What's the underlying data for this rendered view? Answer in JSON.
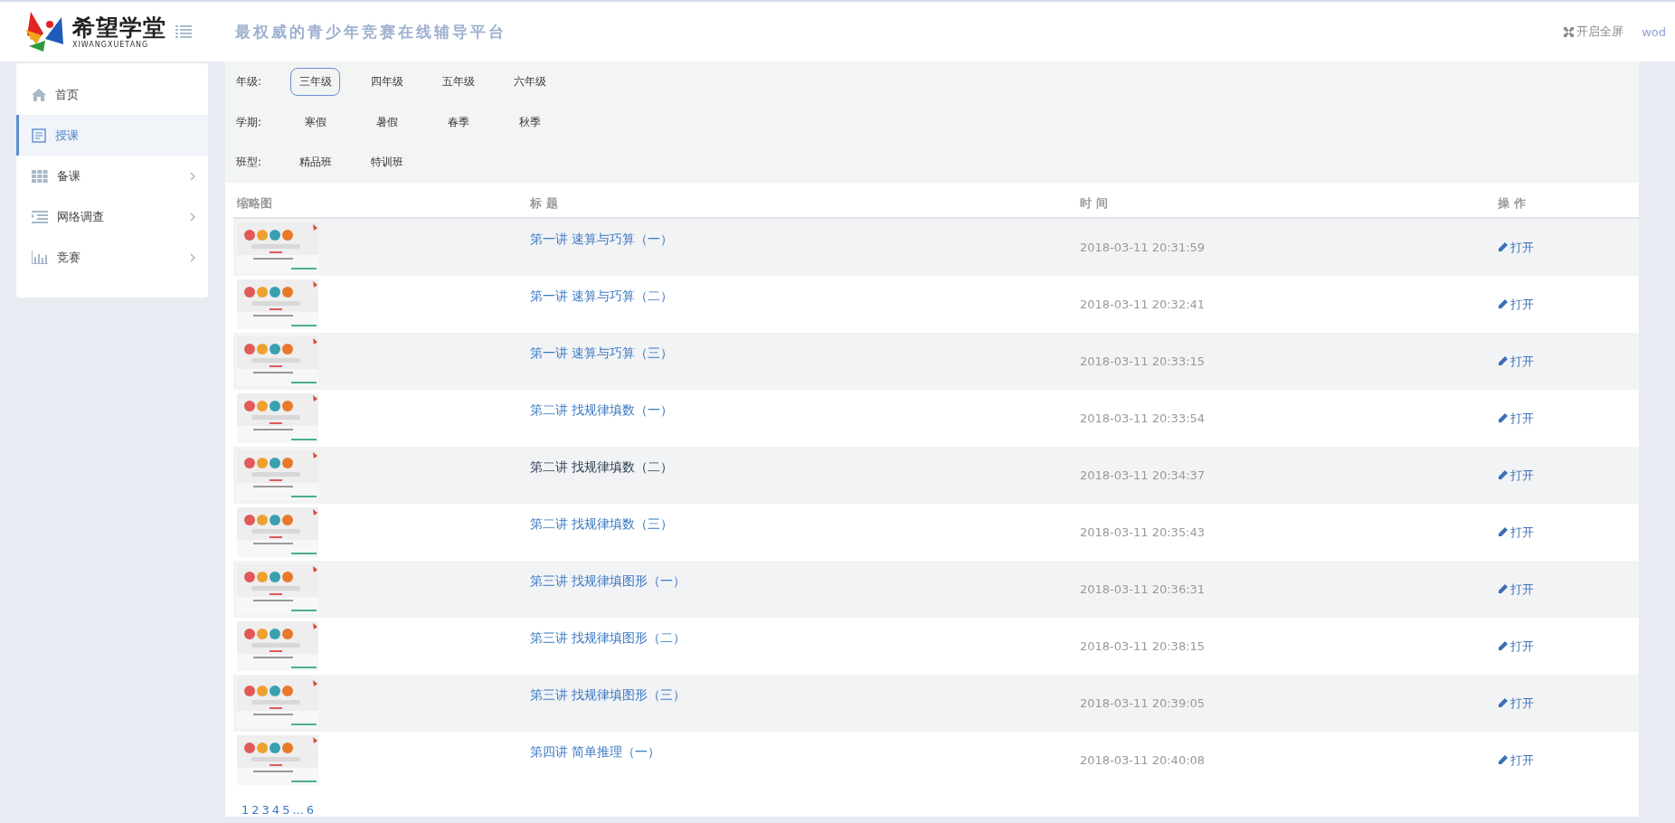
{
  "header": {
    "brand": "希望学堂",
    "brand_sub": "XIWANGXUETANG",
    "slogan": "最权威的青少年竞赛在线辅导平台",
    "fullscreen": "开启全屏",
    "user": "wod"
  },
  "sidebar": {
    "items": [
      {
        "label": "首页",
        "selected": false,
        "expandable": false
      },
      {
        "label": "授课",
        "selected": true,
        "expandable": false
      },
      {
        "label": "备课",
        "selected": false,
        "expandable": true
      },
      {
        "label": "网络调查",
        "selected": false,
        "expandable": true
      },
      {
        "label": "竞赛",
        "selected": false,
        "expandable": true
      }
    ]
  },
  "filters": [
    {
      "label": "年级:",
      "options": [
        {
          "label": "三年级",
          "selected": true
        },
        {
          "label": "四年级",
          "selected": false
        },
        {
          "label": "五年级",
          "selected": false
        },
        {
          "label": "六年级",
          "selected": false
        }
      ]
    },
    {
      "label": "学期:",
      "options": [
        {
          "label": "寒假",
          "selected": false
        },
        {
          "label": "暑假",
          "selected": false
        },
        {
          "label": "春季",
          "selected": false
        },
        {
          "label": "秋季",
          "selected": false
        }
      ]
    },
    {
      "label": "班型:",
      "options": [
        {
          "label": "精品班",
          "selected": false
        },
        {
          "label": "特训班",
          "selected": false
        }
      ]
    }
  ],
  "table": {
    "columns": [
      "缩略图",
      "标 题",
      "时 间",
      "操 作"
    ],
    "rows": [
      {
        "title": "第一讲 速算与巧算（一）",
        "time": "2018-03-11 20:31:59",
        "action": "打开",
        "visited": false
      },
      {
        "title": "第一讲 速算与巧算（二）",
        "time": "2018-03-11 20:32:41",
        "action": "打开",
        "visited": false
      },
      {
        "title": "第一讲 速算与巧算（三）",
        "time": "2018-03-11 20:33:15",
        "action": "打开",
        "visited": false
      },
      {
        "title": "第二讲 找规律填数（一）",
        "time": "2018-03-11 20:33:54",
        "action": "打开",
        "visited": false
      },
      {
        "title": "第二讲 找规律填数（二）",
        "time": "2018-03-11 20:34:37",
        "action": "打开",
        "visited": true
      },
      {
        "title": "第二讲 找规律填数（三）",
        "time": "2018-03-11 20:35:43",
        "action": "打开",
        "visited": false
      },
      {
        "title": "第三讲 找规律填图形（一）",
        "time": "2018-03-11 20:36:31",
        "action": "打开",
        "visited": false
      },
      {
        "title": "第三讲 找规律填图形（二）",
        "time": "2018-03-11 20:38:15",
        "action": "打开",
        "visited": false
      },
      {
        "title": "第三讲 找规律填图形（三）",
        "time": "2018-03-11 20:39:05",
        "action": "打开",
        "visited": false
      },
      {
        "title": "第四讲 简单推理（一）",
        "time": "2018-03-11 20:40:08",
        "action": "打开",
        "visited": false
      }
    ]
  },
  "pagination": [
    "1",
    "2",
    "3",
    "4",
    "5",
    "...",
    "6"
  ]
}
